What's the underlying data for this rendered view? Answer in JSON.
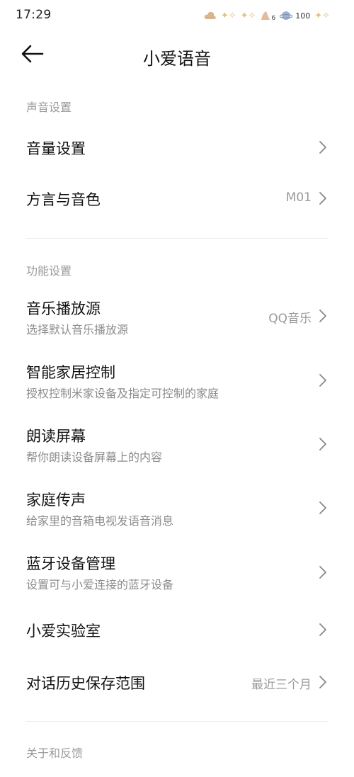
{
  "status_bar": {
    "time": "17:29",
    "notification_count": "6",
    "battery": "100"
  },
  "header": {
    "title": "小爱语音"
  },
  "sections": {
    "sound": {
      "header": "声音设置",
      "volume": {
        "title": "音量设置"
      },
      "dialect": {
        "title": "方言与音色",
        "value": "M01"
      }
    },
    "function": {
      "header": "功能设置",
      "music": {
        "title": "音乐播放源",
        "subtitle": "选择默认音乐播放源",
        "value": "QQ音乐"
      },
      "smart_home": {
        "title": "智能家居控制",
        "subtitle": "授权控制米家设备及指定可控制的家庭"
      },
      "read_screen": {
        "title": "朗读屏幕",
        "subtitle": "帮你朗读设备屏幕上的内容"
      },
      "broadcast": {
        "title": "家庭传声",
        "subtitle": "给家里的音箱电视发语音消息"
      },
      "bluetooth": {
        "title": "蓝牙设备管理",
        "subtitle": "设置可与小爱连接的蓝牙设备"
      },
      "lab": {
        "title": "小爱实验室"
      },
      "history": {
        "title": "对话历史保存范围",
        "value": "最近三个月"
      }
    },
    "about": {
      "header": "关于和反馈"
    }
  }
}
